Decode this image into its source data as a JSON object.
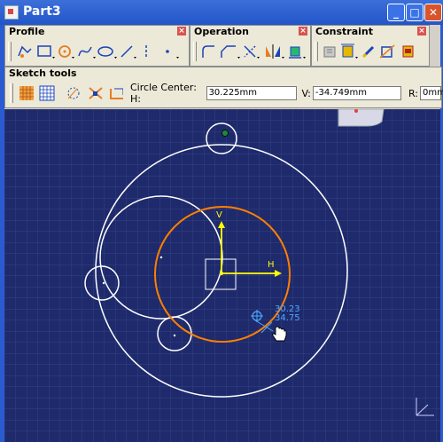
{
  "window": {
    "title": "Part3",
    "minimize": "_",
    "maximize": "□",
    "close": "✕"
  },
  "toolbars": {
    "profile": {
      "title": "Profile",
      "close": "×"
    },
    "operation": {
      "title": "Operation",
      "close": "×"
    },
    "constraint": {
      "title": "Constraint",
      "close": "×"
    },
    "sketch_tools": {
      "title": "Sketch tools",
      "circle_center_label": "Circle Center: H:",
      "h_value": "30.225mm",
      "v_label": "V:",
      "v_value": "-34.749mm",
      "r_label": "R:",
      "r_value": "0mm"
    }
  },
  "canvas": {
    "axis_h_label": "H",
    "axis_v_label": "V",
    "cursor_readout_h": "30.23",
    "cursor_readout_v": "34.75",
    "colors": {
      "background": "#1e2a6b",
      "grid": "#3b4a8c",
      "circle": "#ffffff",
      "selected_circle": "#ff7f00",
      "axis": "#ffff00",
      "readout": "#4fa9ff"
    }
  }
}
